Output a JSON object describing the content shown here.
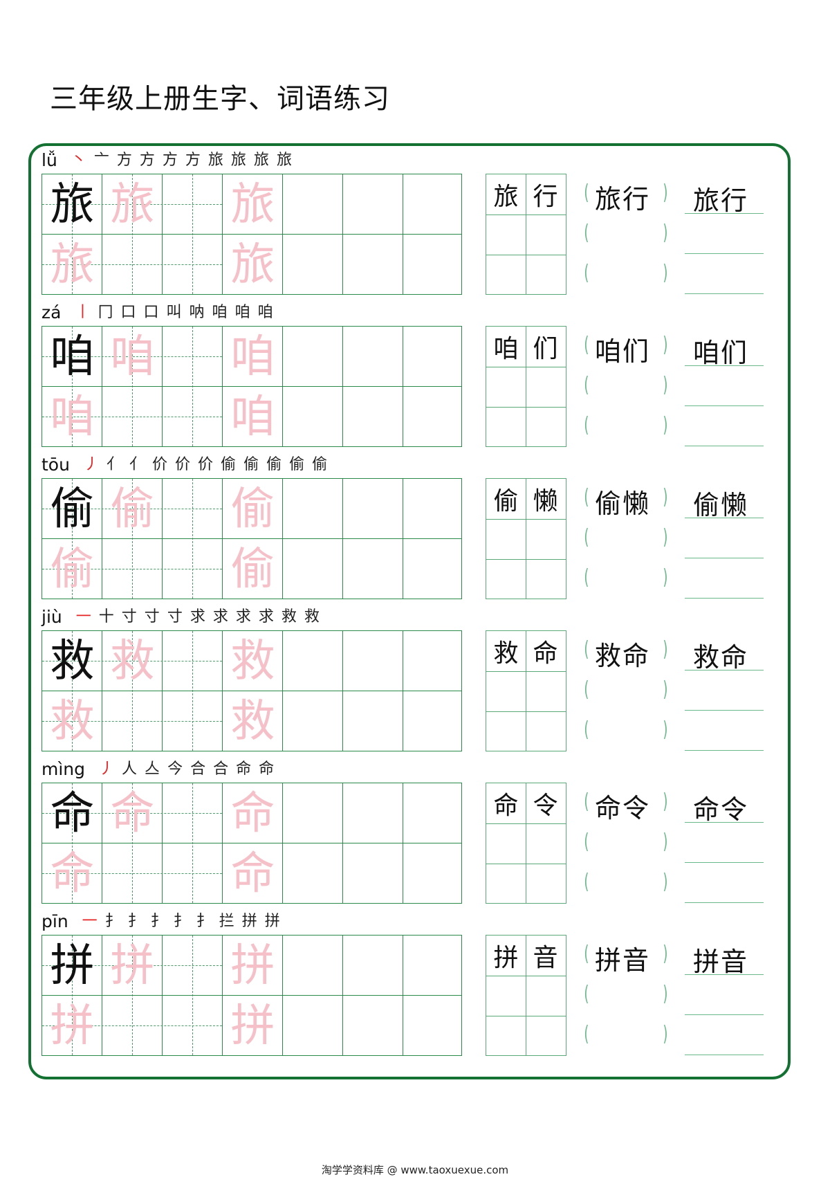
{
  "title": "三年级上册生字、词语练习",
  "colors": {
    "frame": "#137232",
    "grid": "#2a8a4a",
    "trace": "#f6c0c8",
    "stroke_highlight": "#e62222"
  },
  "sections": [
    {
      "pinyin": "lǚ",
      "character": "旅",
      "strokes": [
        "丶",
        "亠",
        "方",
        "方",
        "方",
        "方",
        "旅",
        "旅",
        "旅",
        "旅"
      ],
      "word": [
        "旅",
        "行"
      ],
      "word_text": "旅行"
    },
    {
      "pinyin": "zá",
      "character": "咱",
      "strokes": [
        "丨",
        "冂",
        "口",
        "口",
        "叫",
        "呐",
        "咱",
        "咱",
        "咱"
      ],
      "word": [
        "咱",
        "们"
      ],
      "word_text": "咱们"
    },
    {
      "pinyin": "tōu",
      "character": "偷",
      "strokes": [
        "丿",
        "亻",
        "亻",
        "价",
        "价",
        "价",
        "偷",
        "偷",
        "偷",
        "偷",
        "偷"
      ],
      "word": [
        "偷",
        "懒"
      ],
      "word_text": "偷懒"
    },
    {
      "pinyin": "jiù",
      "character": "救",
      "strokes": [
        "一",
        "十",
        "寸",
        "寸",
        "寸",
        "求",
        "求",
        "求",
        "求",
        "救",
        "救"
      ],
      "word": [
        "救",
        "命"
      ],
      "word_text": "救命"
    },
    {
      "pinyin": "mìng",
      "character": "命",
      "strokes": [
        "丿",
        "人",
        "亼",
        "今",
        "合",
        "合",
        "命",
        "命"
      ],
      "word": [
        "命",
        "令"
      ],
      "word_text": "命令"
    },
    {
      "pinyin": "pīn",
      "character": "拼",
      "strokes": [
        "一",
        "扌",
        "扌",
        "扌",
        "扌",
        "扌",
        "拦",
        "拼",
        "拼"
      ],
      "word": [
        "拼",
        "音"
      ],
      "word_text": "拼音"
    }
  ],
  "paren": {
    "left": "(",
    "right": ")"
  },
  "footer": "淘学学资料库 @ www.taoxuexue.com"
}
